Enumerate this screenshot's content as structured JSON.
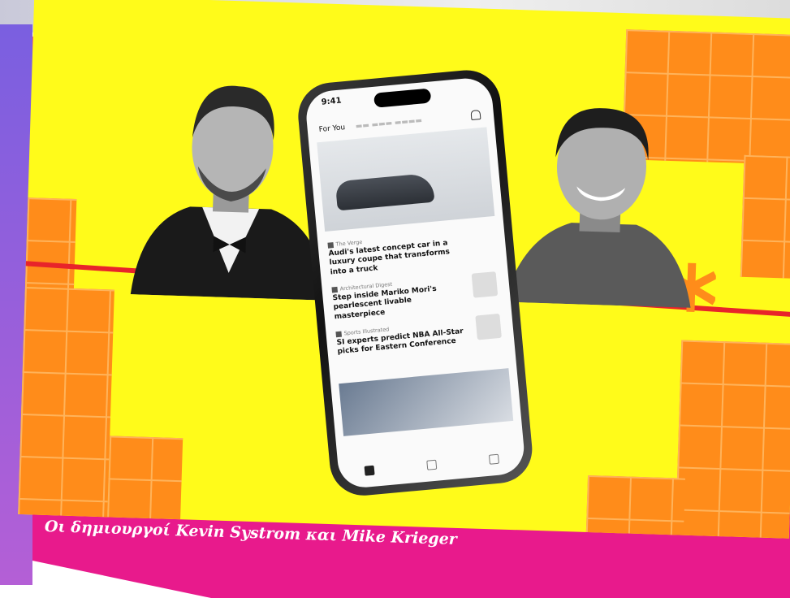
{
  "image": {
    "caption": "Οι δημιουργοί Kevin Systrom και Mike Krieger",
    "colors": {
      "background": "#e81a8c",
      "panel": "#fffb1a",
      "grid": "#ff8c1a",
      "line": "#e8242a"
    },
    "phone": {
      "time": "9:41",
      "tab_active": "For You",
      "articles": [
        {
          "source": "The Verge",
          "title": "Audi's latest concept car in a luxury coupe that transforms into a truck"
        },
        {
          "source": "Architectural Digest",
          "title": "Step inside Mariko Mori's pearlescent livable masterpiece"
        },
        {
          "source": "Sports Illustrated",
          "title": "SI experts predict NBA All-Star picks for Eastern Conference"
        }
      ]
    }
  }
}
